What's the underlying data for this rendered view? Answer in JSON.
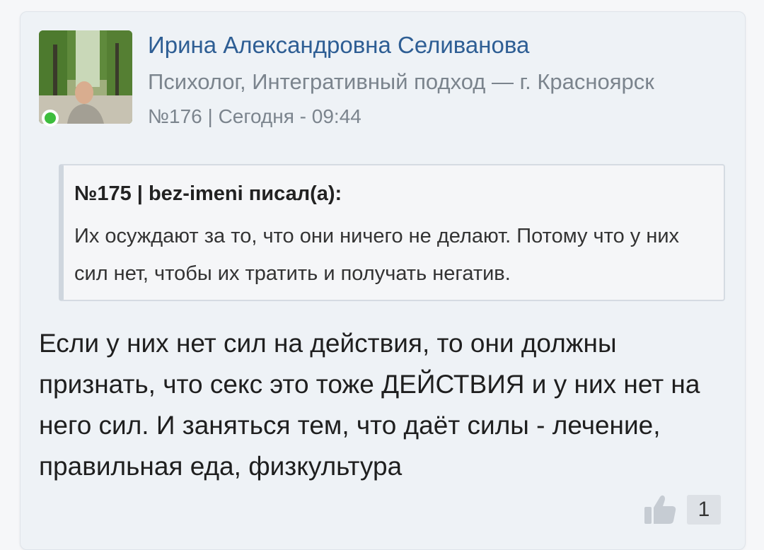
{
  "post": {
    "author": {
      "name": "Ирина Александровна Селиванова",
      "role": "Психолог, Интегративный подход — г. Красноярск",
      "online_status_color": "#3dbd3d"
    },
    "meta": "№176 | Сегодня - 09:44",
    "quote": {
      "header": "№175 | bez-imeni писал(а):",
      "text": "Их осуждают за то, что они ничего не делают. Потому что у них сил нет, чтобы их тратить и получать негатив."
    },
    "body": "Если у них нет сил на действия, то они должны признать, что секс это тоже ДЕЙСТВИЯ и у них нет на него сил. И заняться тем, что даёт силы - лечение, правильная еда, физкультура",
    "likes": {
      "icon": "thumbs-up-icon",
      "count": "1"
    }
  },
  "colors": {
    "author_link": "#2e5e94",
    "meta_text": "#7b848d",
    "card_background": "#eef2f6"
  }
}
